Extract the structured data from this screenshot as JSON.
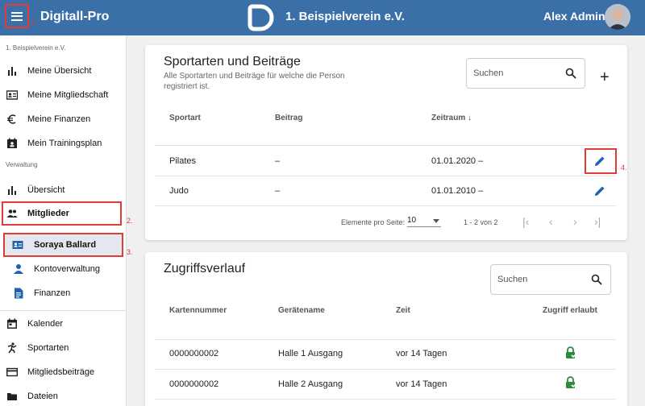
{
  "header": {
    "app_title": "Digitall-Pro",
    "club_name": "1. Beispielverein e.V.",
    "user_name": "Alex Admin",
    "marker_1": "1."
  },
  "sidebar": {
    "club_section": "1. Beispielverein e.V.",
    "admin_section": "Verwaltung",
    "items": [
      {
        "label": "Meine Übersicht",
        "icon": "bar-chart-icon"
      },
      {
        "label": "Meine Mitgliedschaft",
        "icon": "member-card-icon"
      },
      {
        "label": "Meine Finanzen",
        "icon": "euro-icon"
      },
      {
        "label": "Mein Trainingsplan",
        "icon": "calendar-person-icon"
      }
    ],
    "admin_items": [
      {
        "label": "Übersicht",
        "icon": "bar-chart-icon"
      },
      {
        "label": "Mitglieder",
        "icon": "people-icon",
        "marker": "2."
      },
      {
        "label": "Soraya Ballard",
        "icon": "id-card-icon",
        "marker": "3."
      },
      {
        "label": "Kontoverwaltung",
        "icon": "person-icon"
      },
      {
        "label": "Finanzen",
        "icon": "document-icon"
      }
    ],
    "bottom_items": [
      {
        "label": "Kalender",
        "icon": "calendar-icon"
      },
      {
        "label": "Sportarten",
        "icon": "sport-icon"
      },
      {
        "label": "Mitgliedsbeiträge",
        "icon": "credit-card-icon"
      },
      {
        "label": "Dateien",
        "icon": "folder-icon"
      }
    ]
  },
  "sports_card": {
    "title": "Sportarten und Beiträge",
    "description": "Alle Sportarten und Beiträge für welche die Person registriert ist.",
    "search_placeholder": "Suchen",
    "add_label": "+",
    "columns": [
      "Sportart",
      "Beitrag",
      "Zeitraum ↓"
    ],
    "rows": [
      {
        "sport": "Pilates",
        "fee": "–",
        "period": "01.01.2020 –"
      },
      {
        "sport": "Judo",
        "fee": "–",
        "period": "01.01.2010 –"
      }
    ],
    "edit_marker": "4.",
    "pager": {
      "per_page_label": "Elemente pro Seite:",
      "per_page_value": "10",
      "range": "1 - 2 von 2"
    }
  },
  "access_card": {
    "title": "Zugriffsverlauf",
    "search_placeholder": "Suchen",
    "columns": [
      "Kartennummer",
      "Gerätename",
      "Zeit",
      "Zugriff erlaubt"
    ],
    "rows": [
      {
        "card": "0000000002",
        "device": "Halle 1 Ausgang",
        "time": "vor 14 Tagen",
        "allowed": true
      },
      {
        "card": "0000000002",
        "device": "Halle 2 Ausgang",
        "time": "vor 14 Tagen",
        "allowed": true
      }
    ]
  },
  "colors": {
    "header": "#3a6fa8",
    "accent_blue": "#1e62b0",
    "highlight_red": "#e53935",
    "access_green": "#2e8b3d"
  }
}
